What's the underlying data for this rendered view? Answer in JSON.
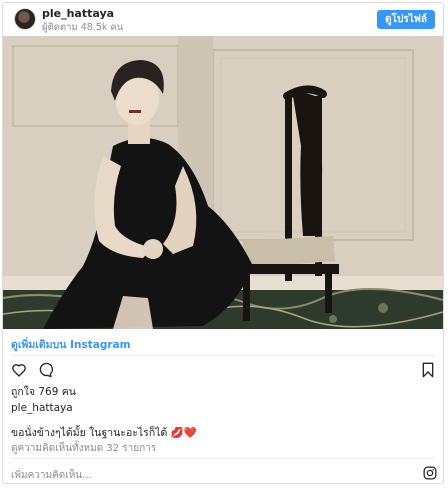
{
  "header": {
    "username": "ple_hattaya",
    "followers": "ผู้ติดตาม 48.5k คน",
    "view_profile_label": "ดูโปรไฟล์"
  },
  "photo": {
    "description_icon": "photo-woman-seated-chair"
  },
  "more_link": "ดูเพิ่มเติมบน Instagram",
  "actions": {
    "like_icon": "heart-icon",
    "comment_icon": "comment-icon",
    "save_icon": "bookmark-icon"
  },
  "likes_text": "ถูกใจ 769 คน",
  "owner": "ple_hattaya",
  "caption": {
    "text": "ขอนั่งข้างๆได้มั้ย ในฐานะอะไรก็ได้",
    "emoji": "💋❤️"
  },
  "view_comments": "ดูความคิดเห็นทั้งหมด 32 รายการ",
  "add_comment_placeholder": "เพิ่มความคิดเห็น...",
  "colors": {
    "accent": "#3897f0",
    "text": "#262626",
    "muted": "#8e8e8e",
    "border": "#dbdbdb"
  }
}
